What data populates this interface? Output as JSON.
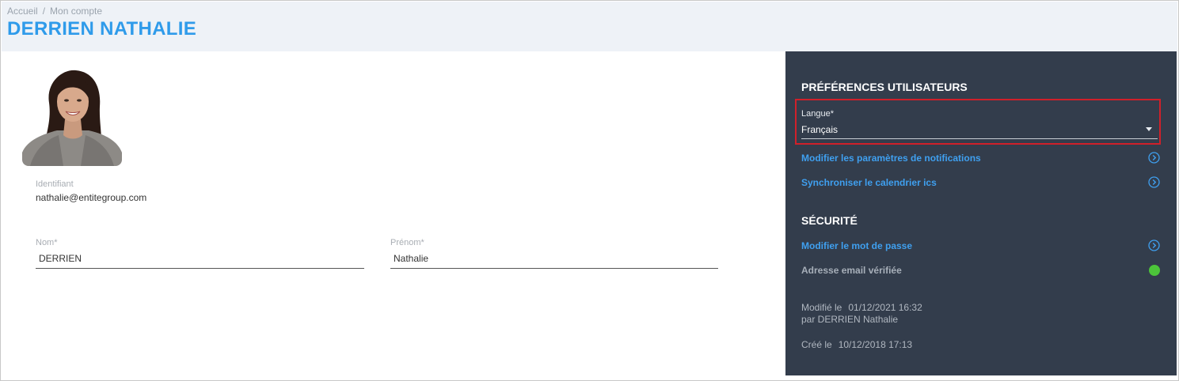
{
  "breadcrumb": {
    "home": "Accueil",
    "separator": "/",
    "current": "Mon compte"
  },
  "page_title": "DERRIEN NATHALIE",
  "profile": {
    "identifiant_label": "Identifiant",
    "identifiant_value": "nathalie@entitegroup.com",
    "nom_label": "Nom*",
    "nom_value": "DERRIEN",
    "prenom_label": "Prénom*",
    "prenom_value": "Nathalie"
  },
  "preferences": {
    "title": "PRÉFÉRENCES UTILISATEURS",
    "langue_label": "Langue*",
    "langue_value": "Français",
    "notifications_link": "Modifier les paramètres de notifications",
    "calendar_link": "Synchroniser le calendrier ics"
  },
  "security": {
    "title": "SÉCURITÉ",
    "password_link": "Modifier le mot de passe",
    "email_verified": "Adresse email vérifiée",
    "email_verified_status_color": "#4cc43a"
  },
  "meta": {
    "modified_label": "Modifié le",
    "modified_date": "01/12/2021 16:32",
    "modified_by": "par DERRIEN Nathalie",
    "created_label": "Créé le",
    "created_date": "10/12/2018 17:13"
  },
  "colors": {
    "accent": "#2f9bea",
    "link": "#3fa0f0",
    "panel_bg": "#333d4c",
    "highlight_border": "#d0202a"
  },
  "icons": {
    "chevron": "chevron-right-circle-icon",
    "dropdown": "caret-down-icon",
    "status": "status-dot-icon"
  }
}
